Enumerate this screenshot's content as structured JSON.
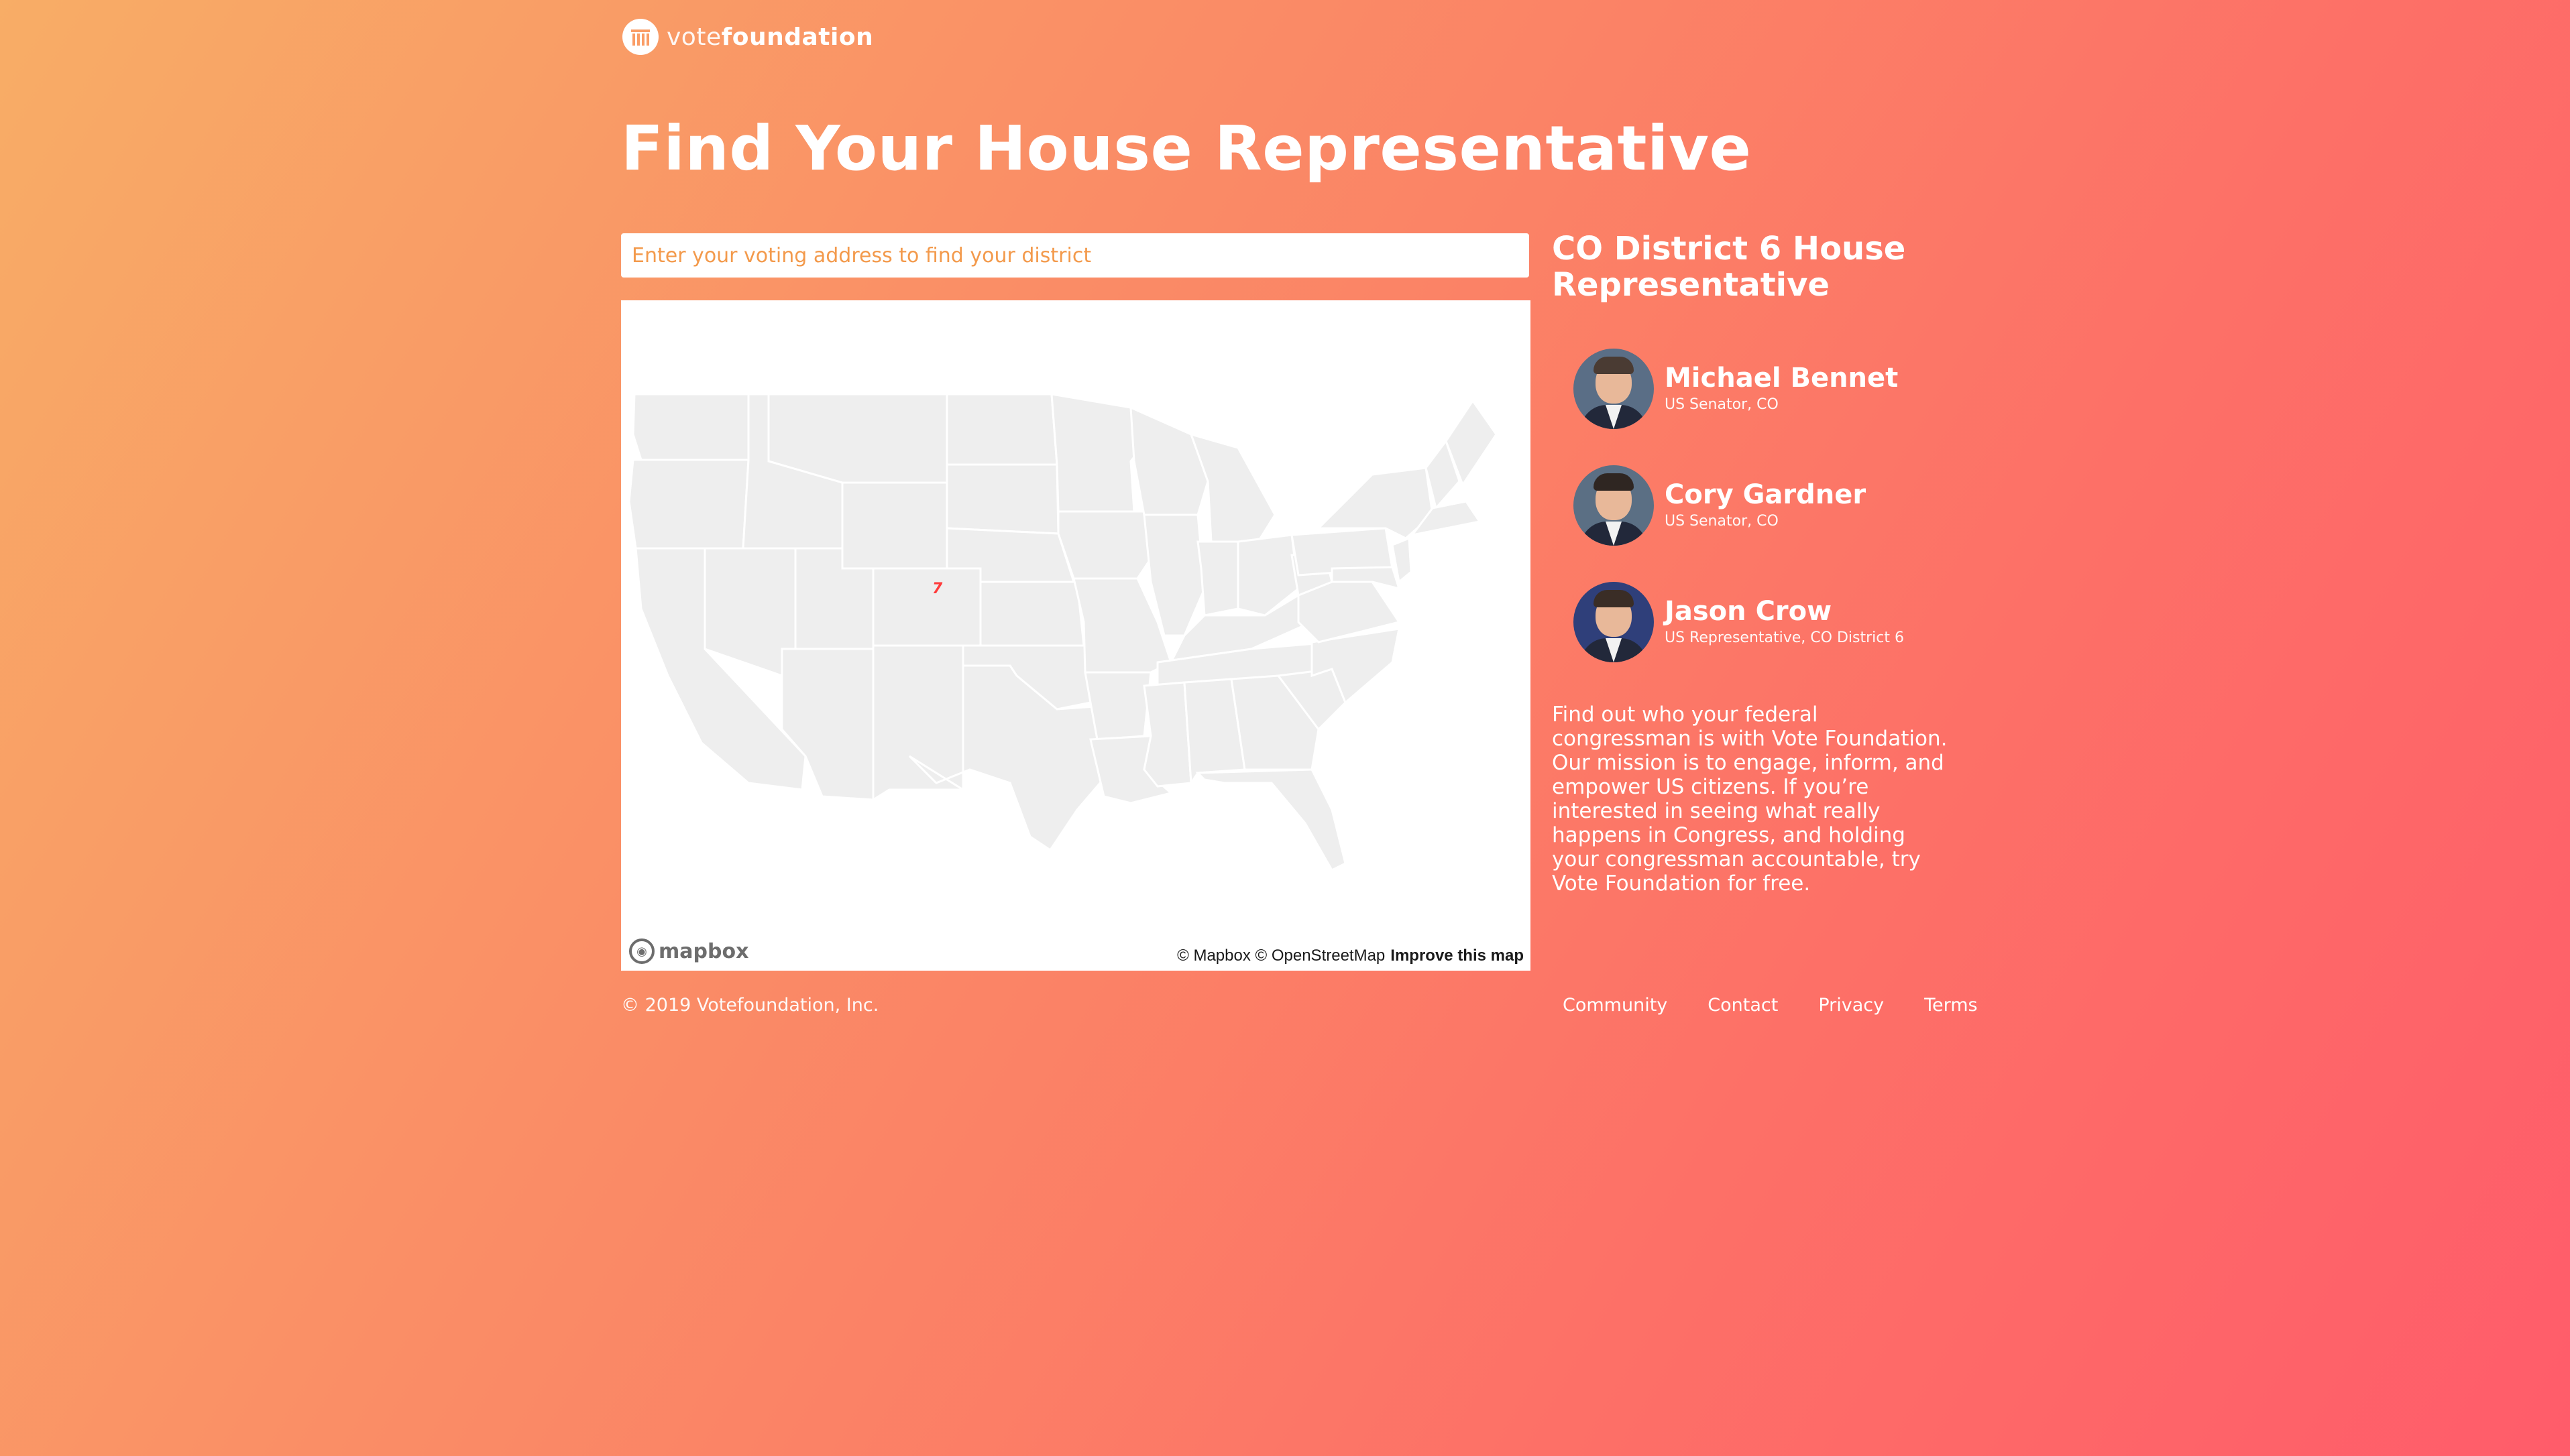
{
  "brand": {
    "logo_light": "vote",
    "logo_bold": "foundation"
  },
  "header": {
    "title": "Find Your House Representative"
  },
  "search": {
    "placeholder": "Enter your voting address to find your district",
    "value": ""
  },
  "map": {
    "marker_label": "7",
    "logo_text": "mapbox",
    "attribution": "© Mapbox © OpenStreetMap",
    "improve_link": "Improve this map"
  },
  "district": {
    "heading": "CO District 6 House Representative"
  },
  "representatives": [
    {
      "name": "Michael Bennet",
      "role": "US Senator, CO"
    },
    {
      "name": "Cory Gardner",
      "role": "US Senator, CO"
    },
    {
      "name": "Jason Crow",
      "role": "US Representative, CO District 6"
    }
  ],
  "mission_text": "Find out who your federal congressman is with Vote Foundation. Our mission is to engage, inform, and empower US citizens. If you’re interested in seeing what really happens in Congress, and holding your congressman accountable, try Vote Foundation for free.",
  "footer": {
    "copyright": "© 2019 Votefoundation, Inc.",
    "links": [
      "Community",
      "Contact",
      "Privacy",
      "Terms"
    ]
  },
  "colors": {
    "gradient_start": "#f8ad66",
    "gradient_end": "#ff5c6a",
    "state_fill": "#eeeeee",
    "state_border": "#ffffff",
    "marker": "#ff3b3b"
  }
}
